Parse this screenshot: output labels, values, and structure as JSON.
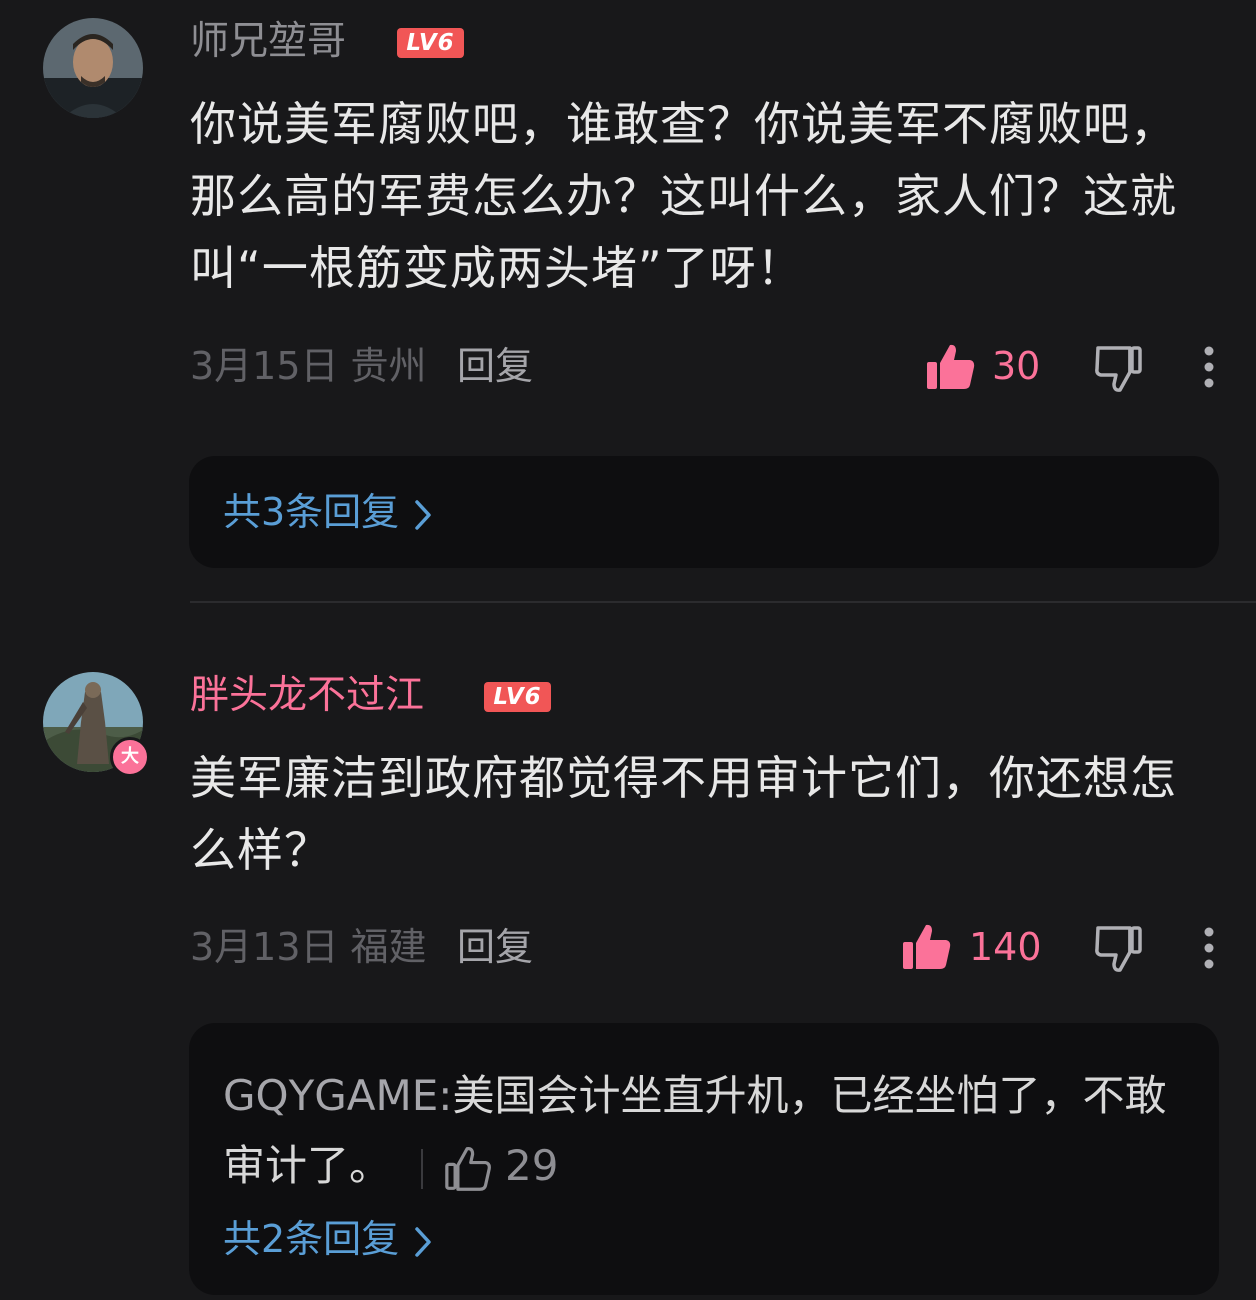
{
  "comments": [
    {
      "username": "师兄堃哥",
      "level": "LV6",
      "content": "你说美军腐败吧，谁敢查？你说美军不腐败吧，那么高的军费怎么办？这叫什么，家人们？这就叫“一根筋变成两头堵”了呀！",
      "date": "3月15日",
      "location": "贵州",
      "reply_label": "回复",
      "likes": "30",
      "replies_link": "共3条回复"
    },
    {
      "username": "胖头龙不过江",
      "level": "LV6",
      "avatar_badge": "大",
      "content": "美军廉洁到政府都觉得不用审计它们，你还想怎么样？",
      "date": "3月13日",
      "location": "福建",
      "reply_label": "回复",
      "likes": "140",
      "sub_reply": {
        "user": "GQYGAME:",
        "text": "美国会计坐直升机，已经坐怕了，不敢审计了。",
        "likes": "29"
      },
      "replies_link": "共2条回复"
    }
  ],
  "colors": {
    "background": "#18181a",
    "accent_pink": "#fb7299",
    "link_blue": "#5a9ed6",
    "level_red": "#f15656"
  },
  "icons": [
    "thumbs-up-icon",
    "thumbs-down-icon",
    "more-vertical-icon",
    "chevron-right-icon"
  ]
}
